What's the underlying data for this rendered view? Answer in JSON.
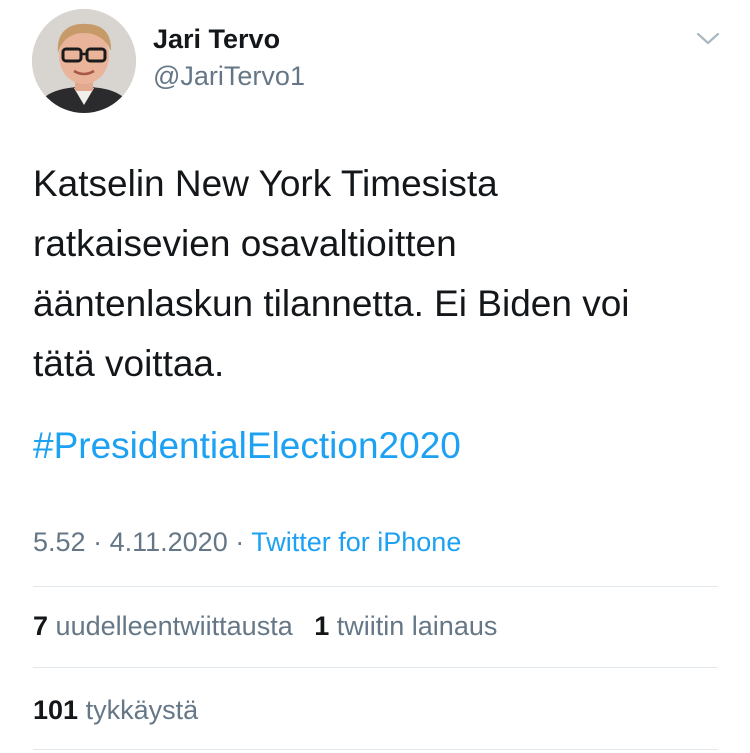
{
  "author": {
    "name": "Jari Tervo",
    "handle": "@JariTervo1"
  },
  "icons": {
    "menu": "chevron-down-icon",
    "avatar": "profile-photo"
  },
  "tweet": {
    "lines": [
      "Katselin New York Timesista",
      "ratkaisevien osavaltioitten",
      "ääntenlaskun tilannetta. Ei Biden voi",
      "tätä voittaa."
    ],
    "hashtag": "#PresidentialElection2020"
  },
  "meta": {
    "time": "5.52",
    "separator": "·",
    "date": "4.11.2020",
    "source": "Twitter for iPhone"
  },
  "stats": {
    "retweets": {
      "count": "7",
      "label": "uudelleentwiittausta"
    },
    "quotes": {
      "count": "1",
      "label": "twiitin lainaus"
    },
    "likes": {
      "count": "101",
      "label": "tykkäystä"
    }
  },
  "colors": {
    "text": "#14171a",
    "secondary": "#657786",
    "link": "#1da1f2",
    "divider": "#e1e8ed"
  }
}
